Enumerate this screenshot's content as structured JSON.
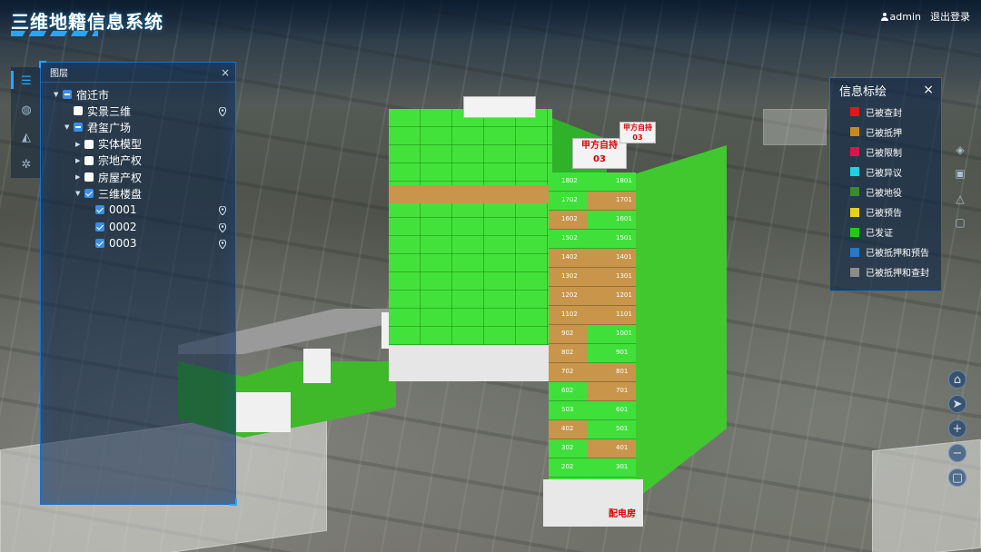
{
  "header": {
    "app_title": "三维地籍信息系统",
    "username": "admin",
    "logout_label": "退出登录"
  },
  "left_rail": {
    "icons": [
      "layers-icon",
      "palette-icon",
      "measure-icon",
      "settings-icon"
    ]
  },
  "layer_panel": {
    "title": "图层",
    "tree": [
      {
        "label": "宿迁市",
        "state": "half",
        "expanded": true,
        "level": 0,
        "location": false
      },
      {
        "label": "实景三维",
        "state": "off",
        "expanded": null,
        "level": 1,
        "location": true
      },
      {
        "label": "君玺广场",
        "state": "half",
        "expanded": true,
        "level": 1,
        "location": false
      },
      {
        "label": "实体模型",
        "state": "off",
        "expanded": false,
        "level": 2,
        "location": false
      },
      {
        "label": "宗地产权",
        "state": "off",
        "expanded": false,
        "level": 2,
        "location": false
      },
      {
        "label": "房屋产权",
        "state": "off",
        "expanded": false,
        "level": 2,
        "location": false
      },
      {
        "label": "三维楼盘",
        "state": "on",
        "expanded": true,
        "level": 2,
        "location": false
      },
      {
        "label": "0001",
        "state": "on",
        "expanded": null,
        "level": 3,
        "location": true
      },
      {
        "label": "0002",
        "state": "on",
        "expanded": null,
        "level": 3,
        "location": true
      },
      {
        "label": "0003",
        "state": "on",
        "expanded": null,
        "level": 3,
        "location": true
      }
    ]
  },
  "legend": {
    "title": "信息标绘",
    "items": [
      {
        "label": "已被查封",
        "color": "#e8141c"
      },
      {
        "label": "已被抵押",
        "color": "#c88a1e"
      },
      {
        "label": "已被限制",
        "color": "#e0144a"
      },
      {
        "label": "已被异议",
        "color": "#18d6e0"
      },
      {
        "label": "已被地役",
        "color": "#3c8c24"
      },
      {
        "label": "已被预告",
        "color": "#e6d21e"
      },
      {
        "label": "已发证",
        "color": "#22c81e"
      },
      {
        "label": "已被抵押和预告",
        "color": "#2878c8"
      },
      {
        "label": "已被抵押和查封",
        "color": "#8c8c8c"
      }
    ]
  },
  "scene": {
    "roof_signs": [
      "甲方自持",
      "03",
      "甲方自持",
      "03"
    ],
    "tower_b_units": [
      {
        "left": "1802",
        "right": "1801",
        "status_left": "green",
        "status_right": "green"
      },
      {
        "left": "1702",
        "right": "1701",
        "status_left": "green",
        "status_right": "brown"
      },
      {
        "left": "1602",
        "right": "1601",
        "status_left": "brown",
        "status_right": "green"
      },
      {
        "left": "1502",
        "right": "1501",
        "status_left": "green",
        "status_right": "green"
      },
      {
        "left": "1402",
        "right": "1401",
        "status_left": "brown",
        "status_right": "brown"
      },
      {
        "left": "1302",
        "right": "1301",
        "status_left": "brown",
        "status_right": "brown"
      },
      {
        "left": "1202",
        "right": "1201",
        "status_left": "brown",
        "status_right": "brown"
      },
      {
        "left": "1102",
        "right": "1101",
        "status_left": "brown",
        "status_right": "brown"
      },
      {
        "left": "902",
        "right": "1001",
        "status_left": "brown",
        "status_right": "green"
      },
      {
        "left": "802",
        "right": "901",
        "status_left": "brown",
        "status_right": "green"
      },
      {
        "left": "702",
        "right": "801",
        "status_left": "brown",
        "status_right": "brown"
      },
      {
        "left": "602",
        "right": "701",
        "status_left": "green",
        "status_right": "brown"
      },
      {
        "left": "503",
        "right": "601",
        "status_left": "green",
        "status_right": "green"
      },
      {
        "left": "402",
        "right": "501",
        "status_left": "brown",
        "status_right": "green"
      },
      {
        "left": "302",
        "right": "401",
        "status_left": "green",
        "status_right": "brown"
      },
      {
        "left": "202",
        "right": "301",
        "status_left": "green",
        "status_right": "green"
      },
      {
        "left": "",
        "right": "201",
        "status_left": "green",
        "status_right": "green"
      }
    ],
    "base_sign": "配电房",
    "tower_a_bands": [
      4,
      7
    ]
  },
  "right_tools": [
    "home-icon",
    "compass-icon",
    "zoom-in-icon",
    "zoom-out-icon",
    "fullscreen-icon"
  ]
}
